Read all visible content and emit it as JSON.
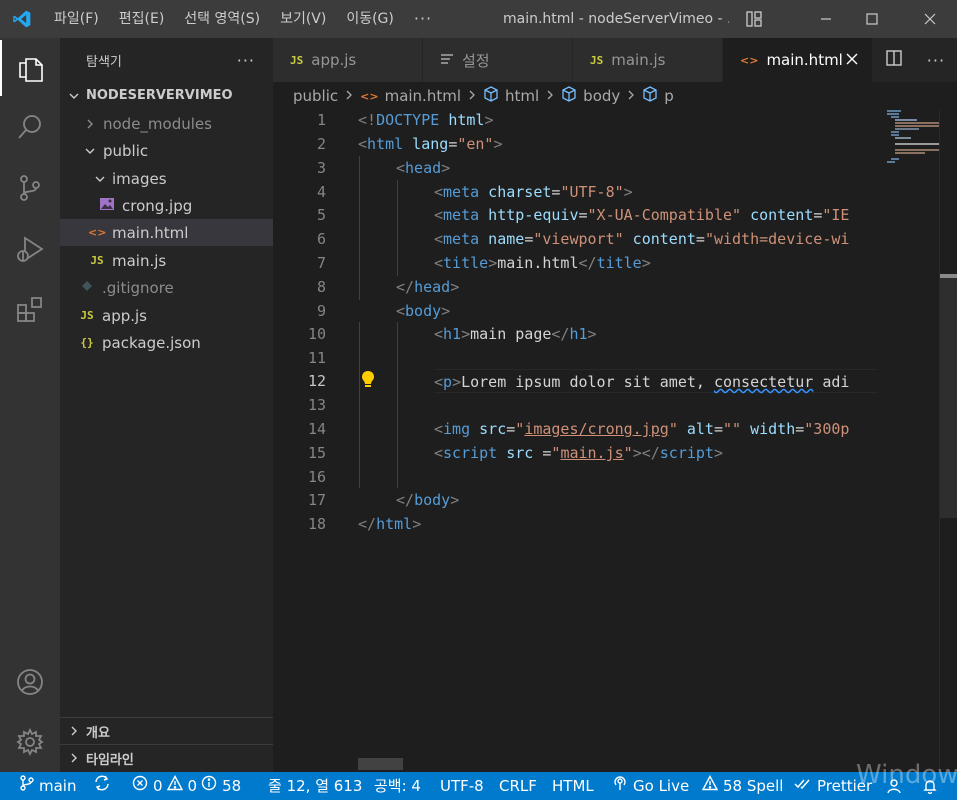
{
  "titlebar": {
    "menus": [
      "파일(F)",
      "편집(E)",
      "선택 영역(S)",
      "보기(V)",
      "이동(G)"
    ],
    "more": "···",
    "title": "main.html - nodeServerVimeo - ..."
  },
  "colors": {
    "accent": "#007acc",
    "vscode_blue": "#23a9f2"
  },
  "sidebar": {
    "header": "탐색기",
    "header_more": "···",
    "project": "NODESERVERVIMEO",
    "tree": [
      {
        "name": "node_modules",
        "icon": "chevron-right-icon"
      },
      {
        "name": "public",
        "icon": "chevron-down-icon"
      },
      {
        "name": "images",
        "icon": "chevron-down-icon"
      },
      {
        "name": "crong.jpg",
        "icon": "image-file-icon"
      },
      {
        "name": "main.html",
        "icon": "html-file-icon"
      },
      {
        "name": "main.js",
        "icon": "js-file-icon"
      },
      {
        "name": ".gitignore",
        "icon": "git-file-icon"
      },
      {
        "name": "app.js",
        "icon": "js-file-icon"
      },
      {
        "name": "package.json",
        "icon": "json-file-icon"
      }
    ],
    "file_badges": {
      "js": "JS",
      "html": "<>",
      "json": "{}"
    },
    "sections": [
      "개요",
      "타임라인"
    ]
  },
  "tabs": [
    {
      "label": "app.js",
      "icon": "js-file-icon"
    },
    {
      "label": "설정",
      "icon": "settings-file-icon"
    },
    {
      "label": "main.js",
      "icon": "js-file-icon"
    },
    {
      "label": "main.html",
      "icon": "html-file-icon"
    }
  ],
  "breadcrumb": [
    "public",
    "main.html",
    "html",
    "body",
    "p"
  ],
  "editor": {
    "line_numbers": [
      "1",
      "2",
      "3",
      "4",
      "5",
      "6",
      "7",
      "8",
      "9",
      "10",
      "11",
      "12",
      "13",
      "14",
      "15",
      "16",
      "17",
      "18"
    ],
    "current_line": "12",
    "lines": {
      "l1": {
        "a": "<!",
        "b": "DOCTYPE",
        "c": " ",
        "d": "html",
        "e": ">"
      },
      "l2": {
        "a": "<",
        "b": "html",
        "c": " lang",
        "d": "=",
        "e": "\"en\"",
        "f": ">"
      },
      "l3": {
        "a": "<",
        "b": "head",
        "c": ">"
      },
      "l4": {
        "a": "<",
        "b": "meta",
        "c": " charset",
        "d": "=",
        "e": "\"UTF-8\"",
        "f": ">"
      },
      "l5": {
        "a": "<",
        "b": "meta",
        "c": " http-equiv",
        "d": "=",
        "e": "\"X-UA-Compatible\"",
        "f": " content",
        "g": "=",
        "h": "\"IE"
      },
      "l6": {
        "a": "<",
        "b": "meta",
        "c": " name",
        "d": "=",
        "e": "\"viewport\"",
        "f": " content",
        "g": "=",
        "h": "\"width=device-wi"
      },
      "l7": {
        "a": "<",
        "b": "title",
        "c": ">",
        "d": "main.html",
        "e": "</",
        "f": "title",
        "g": ">"
      },
      "l8": {
        "a": "</",
        "b": "head",
        "c": ">"
      },
      "l9": {
        "a": "<",
        "b": "body",
        "c": ">"
      },
      "l10": {
        "a": "<",
        "b": "h1",
        "c": ">",
        "d": "main page",
        "e": "</",
        "f": "h1",
        "g": ">"
      },
      "l12": {
        "a": "<",
        "b": "p",
        "c": ">",
        "d": "Lorem ipsum dolor sit amet, ",
        "e": "consectetur",
        "f": " adi"
      },
      "l14": {
        "a": "<",
        "b": "img",
        "c": " src",
        "d": "=",
        "e": "\"",
        "f": "images/crong.jpg",
        "g": "\"",
        "h": " alt",
        "i": "=",
        "j": "\"\"",
        "k": " width",
        "l": "=",
        "m": "\"300p"
      },
      "l15": {
        "a": "<",
        "b": "script",
        "c": " src ",
        "d": "=",
        "e": "\"",
        "f": "main.js",
        "g": "\"",
        "h": "></",
        "i": "script",
        "j": ">"
      },
      "l17": {
        "a": "</",
        "b": "body",
        "c": ">"
      },
      "l18": {
        "a": "</",
        "b": "html",
        "c": ">"
      }
    }
  },
  "statusbar": {
    "branch": "main",
    "errors": "0",
    "warnings": "0",
    "info": "58",
    "position": "줄 12, 열 613",
    "spaces": "공백: 4",
    "encoding": "UTF-8",
    "eol": "CRLF",
    "language": "HTML",
    "golive": "Go Live",
    "spell": "58 Spell",
    "prettier": "Prettier"
  },
  "watermark": "Windows"
}
